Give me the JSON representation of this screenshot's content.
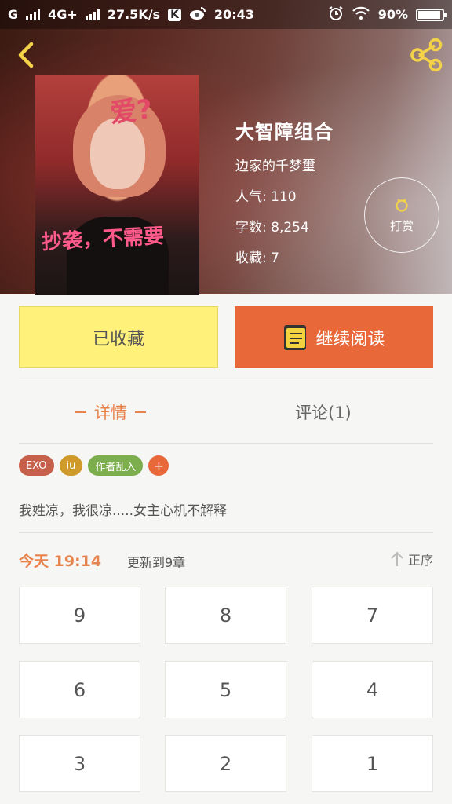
{
  "status_bar": {
    "carrier": "G",
    "network": "4G+",
    "speed": "27.5K/s",
    "k_badge": "K",
    "time": "20:43",
    "battery": "90%"
  },
  "book": {
    "title": "大智障组合",
    "author": "边家的千梦璽",
    "popularity": "人气: 110",
    "word_count": "字数: 8,254",
    "favorites": "收藏: 7",
    "cover_text_top": "爱?",
    "cover_text_bottom": "抄袭，不需要"
  },
  "tip_button": {
    "label": "打赏"
  },
  "actions": {
    "favorite_label": "已收藏",
    "continue_label": "继续阅读"
  },
  "tabs": {
    "detail": "详情",
    "comments": "评论(1)"
  },
  "tags": [
    "EXO",
    "iu",
    "作者乱入"
  ],
  "tag_add": "+",
  "summary": "我姓凉，我很凉.....女主心机不解释",
  "update": {
    "time": "今天 19:14",
    "text": "更新到9章",
    "sort_label": "正序"
  },
  "chapters": [
    "9",
    "8",
    "7",
    "6",
    "5",
    "4",
    "3",
    "2",
    "1"
  ],
  "colors": {
    "accent": "#e9683a",
    "favorite_bg": "#fff17a",
    "tab_active": "#e9834d"
  }
}
